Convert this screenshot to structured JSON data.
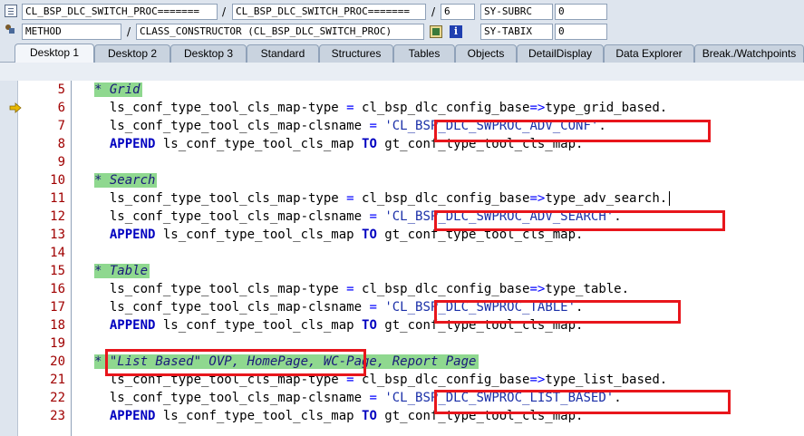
{
  "header": {
    "row1": {
      "field1": "CL_BSP_DLC_SWITCH_PROC=======",
      "field2": "CL_BSP_DLC_SWITCH_PROC=======",
      "field3": "6",
      "sysfield": "SY-SUBRC",
      "sysvalue": "0"
    },
    "row2": {
      "field1": "METHOD",
      "field2": "CLASS_CONSTRUCTOR (CL_BSP_DLC_SWITCH_PROC)",
      "sysfield": "SY-TABIX",
      "sysvalue": "0"
    },
    "separator": "/"
  },
  "tabs": [
    {
      "label": "Desktop 1",
      "active": true
    },
    {
      "label": "Desktop 2"
    },
    {
      "label": "Desktop 3"
    },
    {
      "label": "Standard"
    },
    {
      "label": "Structures"
    },
    {
      "label": "Tables"
    },
    {
      "label": "Objects"
    },
    {
      "label": "DetailDisplay"
    },
    {
      "label": "Data Explorer"
    },
    {
      "label": "Break./Watchpoints"
    }
  ],
  "code": {
    "current_line": 6,
    "lines": [
      {
        "n": "5",
        "parts": [
          [
            "cmt",
            "* Grid"
          ]
        ]
      },
      {
        "n": "6",
        "parts": [
          [
            "",
            "  ls_conf_type_tool_cls_map-type "
          ],
          [
            "op",
            "="
          ],
          [
            "",
            " cl_bsp_dlc_config_base"
          ],
          [
            "op",
            "=>"
          ],
          [
            "",
            "type_grid_based."
          ]
        ]
      },
      {
        "n": "7",
        "parts": [
          [
            "",
            "  ls_conf_type_tool_cls_map-clsname "
          ],
          [
            "op",
            "="
          ],
          [
            "",
            " "
          ],
          [
            "str",
            "'CL_BSP_DLC_SWPROC_ADV_CONF'"
          ],
          [
            "",
            "."
          ]
        ]
      },
      {
        "n": "8",
        "parts": [
          [
            "kw",
            "  APPEND"
          ],
          [
            "",
            " ls_conf_type_tool_cls_map "
          ],
          [
            "kw",
            "TO"
          ],
          [
            "",
            " gt_conf_type_tool_cls_map."
          ]
        ]
      },
      {
        "n": "9",
        "parts": []
      },
      {
        "n": "10",
        "parts": [
          [
            "cmt",
            "* Search"
          ]
        ]
      },
      {
        "n": "11",
        "parts": [
          [
            "",
            "  ls_conf_type_tool_cls_map-type "
          ],
          [
            "op",
            "="
          ],
          [
            "",
            " cl_bsp_dlc_config_base"
          ],
          [
            "op",
            "=>"
          ],
          [
            "",
            "type_adv_search."
          ]
        ]
      },
      {
        "n": "12",
        "parts": [
          [
            "",
            "  ls_conf_type_tool_cls_map-clsname "
          ],
          [
            "op",
            "="
          ],
          [
            "",
            " "
          ],
          [
            "str",
            "'CL_BSP_DLC_SWPROC_ADV_SEARCH'"
          ],
          [
            "",
            "."
          ]
        ]
      },
      {
        "n": "13",
        "parts": [
          [
            "kw",
            "  APPEND"
          ],
          [
            "",
            " ls_conf_type_tool_cls_map "
          ],
          [
            "kw",
            "TO"
          ],
          [
            "",
            " gt_conf_type_tool_cls_map."
          ]
        ]
      },
      {
        "n": "14",
        "parts": []
      },
      {
        "n": "15",
        "parts": [
          [
            "cmt",
            "* Table"
          ]
        ]
      },
      {
        "n": "16",
        "parts": [
          [
            "",
            "  ls_conf_type_tool_cls_map-type "
          ],
          [
            "op",
            "="
          ],
          [
            "",
            " cl_bsp_dlc_config_base"
          ],
          [
            "op",
            "=>"
          ],
          [
            "",
            "type_table."
          ]
        ]
      },
      {
        "n": "17",
        "parts": [
          [
            "",
            "  ls_conf_type_tool_cls_map-clsname "
          ],
          [
            "op",
            "="
          ],
          [
            "",
            " "
          ],
          [
            "str",
            "'CL_BSP_DLC_SWPROC_TABLE'"
          ],
          [
            "",
            "."
          ]
        ]
      },
      {
        "n": "18",
        "parts": [
          [
            "kw",
            "  APPEND"
          ],
          [
            "",
            " ls_conf_type_tool_cls_map "
          ],
          [
            "kw",
            "TO"
          ],
          [
            "",
            " gt_conf_type_tool_cls_map."
          ]
        ]
      },
      {
        "n": "19",
        "parts": []
      },
      {
        "n": "20",
        "parts": [
          [
            "cmt",
            "* \"List Based\" OVP, HomePage, WC-Page, Report Page"
          ]
        ]
      },
      {
        "n": "21",
        "parts": [
          [
            "",
            "  ls_conf_type_tool_cls_map-type "
          ],
          [
            "op",
            "="
          ],
          [
            "",
            " cl_bsp_dlc_config_base"
          ],
          [
            "op",
            "=>"
          ],
          [
            "",
            "type_list_based."
          ]
        ]
      },
      {
        "n": "22",
        "parts": [
          [
            "",
            "  ls_conf_type_tool_cls_map-clsname "
          ],
          [
            "op",
            "="
          ],
          [
            "",
            " "
          ],
          [
            "str",
            "'CL_BSP_DLC_SWPROC_LIST_BASED'"
          ],
          [
            "",
            "."
          ]
        ]
      },
      {
        "n": "23",
        "parts": [
          [
            "kw",
            "  APPEND"
          ],
          [
            "",
            " ls_conf_type_tool_cls_map "
          ],
          [
            "kw",
            "TO"
          ],
          [
            "",
            " gt_conf_type_tool_cls_map."
          ]
        ]
      }
    ]
  },
  "colors": {
    "string": "#1a2fa8",
    "keyword": "#0000c0",
    "comment_background": "#8fd88f",
    "line_number": "#a00000",
    "highlight_box": "#e8161c",
    "current_line_arrow": "#e8b800"
  },
  "icons": {
    "row1_doc": "document-icon",
    "row2_method": "method-icon",
    "row2_display": "display-icon",
    "row2_info": "info-icon",
    "current_line": "arrow-right-icon"
  }
}
